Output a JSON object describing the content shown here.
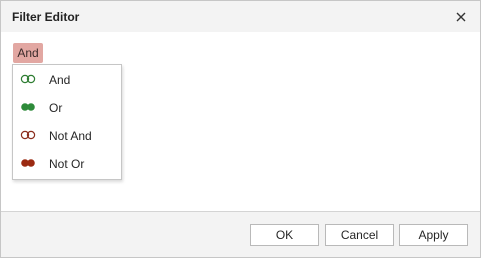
{
  "window": {
    "title": "Filter Editor"
  },
  "chip": {
    "label": "And"
  },
  "menu": {
    "items": [
      {
        "label": "And",
        "icon": "and-rings-icon",
        "color": "#2e7d32",
        "filled": false
      },
      {
        "label": "Or",
        "icon": "or-dots-icon",
        "color": "#2e8b3a",
        "filled": true
      },
      {
        "label": "Not And",
        "icon": "not-and-rings-icon",
        "color": "#8b2e1e",
        "filled": false
      },
      {
        "label": "Not Or",
        "icon": "not-or-dots-icon",
        "color": "#9b2a12",
        "filled": true
      }
    ]
  },
  "buttons": {
    "ok": "OK",
    "cancel": "Cancel",
    "apply": "Apply"
  },
  "colors": {
    "chip_bg": "#e2a7a2",
    "green": "#2e7d32",
    "red": "#9b2a12"
  }
}
